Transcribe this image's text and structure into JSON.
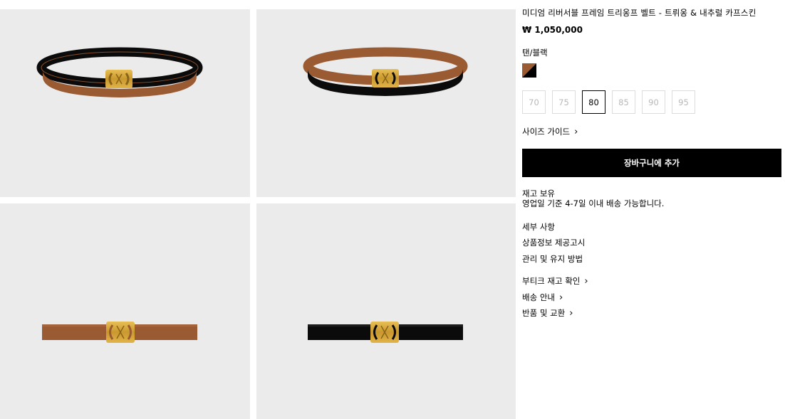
{
  "gallery": {
    "images": [
      {
        "name": "belt-tan-coiled"
      },
      {
        "name": "belt-black-coiled"
      },
      {
        "name": "belt-tan-flat"
      },
      {
        "name": "belt-black-flat"
      }
    ]
  },
  "product": {
    "title": "미디엄 리버서블 프레임 트리옹프 벨트 - 트뤼옹 & 내추럴 카프스킨",
    "price": "₩ 1,050,000",
    "color_name": "탠/블랙",
    "swatch_colors": [
      "#9a5a32",
      "#000000"
    ]
  },
  "sizes": {
    "options": [
      "70",
      "75",
      "80",
      "85",
      "90",
      "95"
    ],
    "selected": "80"
  },
  "size_guide_label": "사이즈 가이드",
  "add_to_cart_label": "장바구니에 추가",
  "stock": {
    "status": "재고 보유",
    "delivery": "영업일 기준 4-7일 이내 배송 가능합니다."
  },
  "details": {
    "details_label": "세부 사항",
    "product_info_label": "상품정보 제공고시",
    "care_label": "관리 및 유지 방법"
  },
  "links": {
    "boutique_stock_label": "부티크 재고 확인",
    "shipping_label": "배송 안내",
    "returns_label": "반품 및 교환"
  },
  "colors": {
    "tan": "#9a5a32",
    "black": "#0b0b0b",
    "gold": "#d4a93c",
    "tile_bg": "#ebebeb"
  }
}
